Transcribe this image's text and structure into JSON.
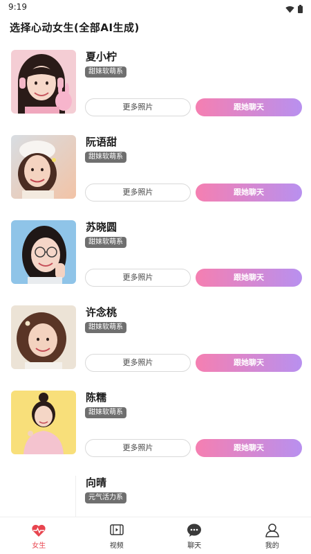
{
  "status_bar": {
    "time": "9:19",
    "icons": [
      "wifi-icon",
      "battery-icon"
    ]
  },
  "page": {
    "title": "选择心动女生(全部AI生成)"
  },
  "girls": [
    {
      "name": "夏小柠",
      "tag": "甜妹软萌系",
      "more_label": "更多照片",
      "chat_label": "跟她聊天"
    },
    {
      "name": "阮语甜",
      "tag": "甜妹软萌系",
      "more_label": "更多照片",
      "chat_label": "跟她聊天"
    },
    {
      "name": "苏晓圆",
      "tag": "甜妹软萌系",
      "more_label": "更多照片",
      "chat_label": "跟她聊天"
    },
    {
      "name": "许念桃",
      "tag": "甜妹软萌系",
      "more_label": "更多照片",
      "chat_label": "跟她聊天"
    },
    {
      "name": "陈糯",
      "tag": "甜妹软萌系",
      "more_label": "更多照片",
      "chat_label": "跟她聊天"
    },
    {
      "name": "向晴",
      "tag": "元气活力系"
    }
  ],
  "tabbar": {
    "items": [
      {
        "label": "女生",
        "icon": "heart-pulse-icon",
        "active": true
      },
      {
        "label": "视频",
        "icon": "video-icon",
        "active": false
      },
      {
        "label": "聊天",
        "icon": "chat-icon",
        "active": false
      },
      {
        "label": "我的",
        "icon": "profile-icon",
        "active": false
      }
    ]
  },
  "colors": {
    "accent_start": "#f57fb1",
    "accent_end": "#b890ef",
    "tab_active": "#e8454f",
    "tag_bg": "#6f6f6f"
  }
}
